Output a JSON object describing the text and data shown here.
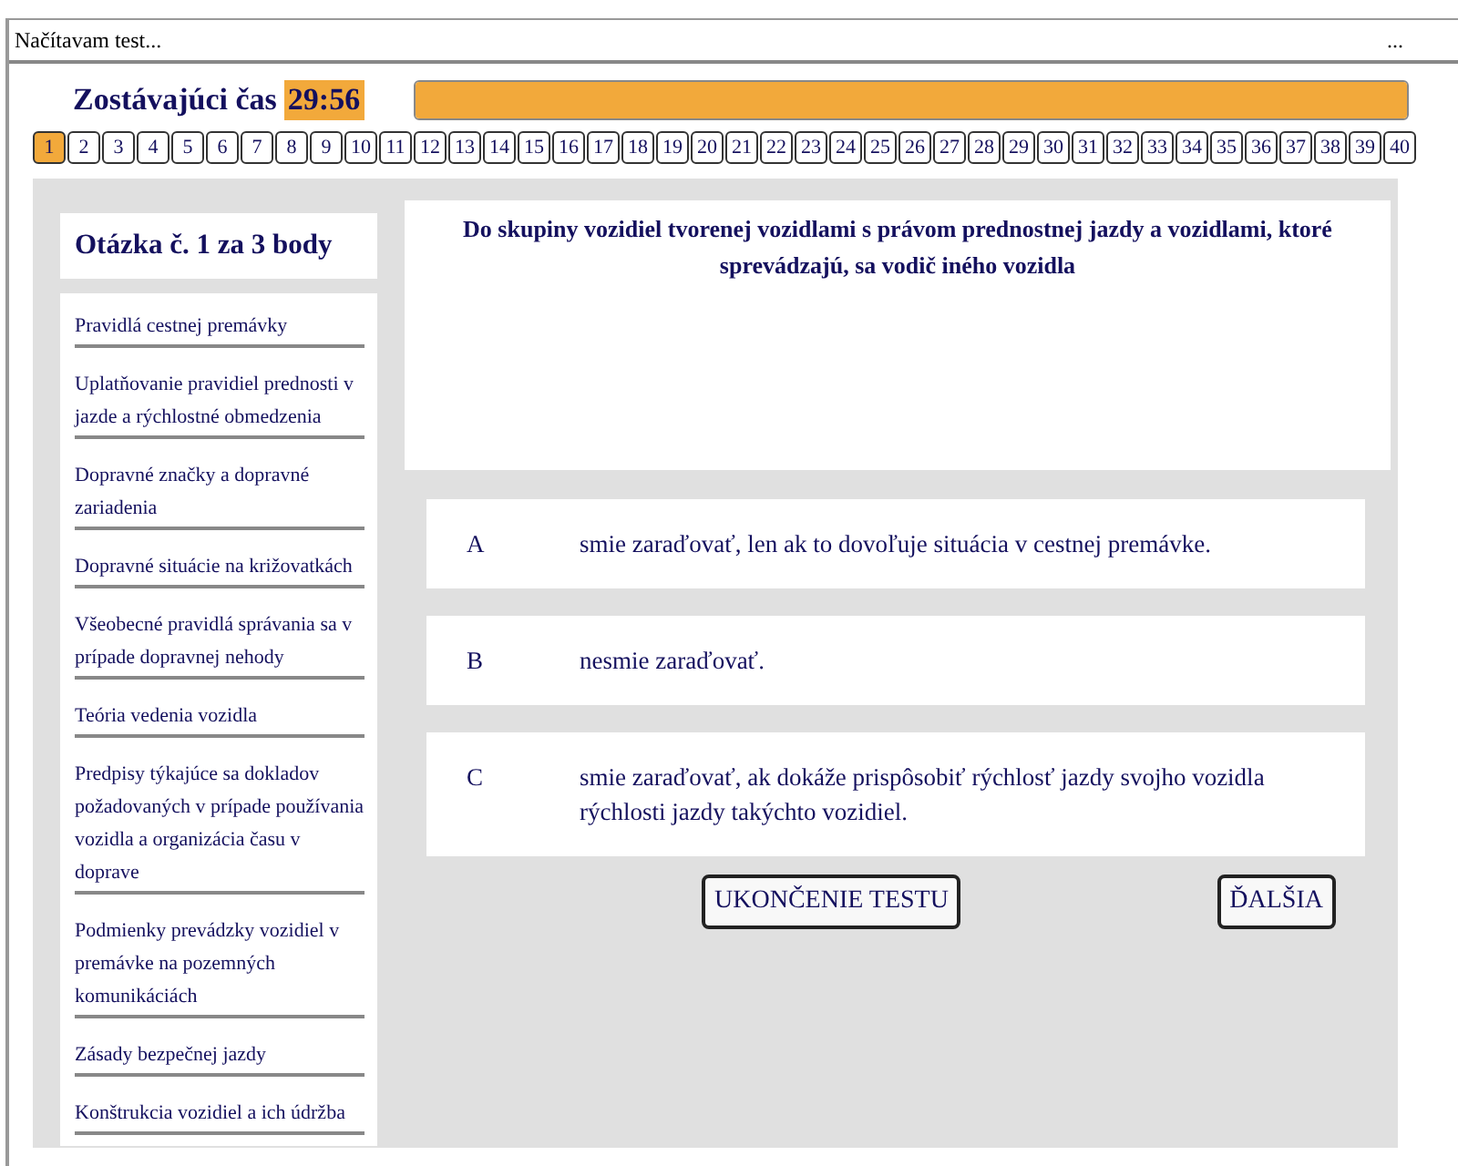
{
  "status_bar": {
    "text": "Načítavam test...",
    "menu": "..."
  },
  "timer": {
    "label": "Zostávajúci čas",
    "time": "29:56",
    "level": 1
  },
  "question_numbers": [
    {
      "label": "1",
      "selected": true
    },
    {
      "label": "2",
      "selected": false
    },
    {
      "label": "3",
      "selected": false
    },
    {
      "label": "4",
      "selected": false
    },
    {
      "label": "5",
      "selected": false
    },
    {
      "label": "6",
      "selected": false
    },
    {
      "label": "7",
      "selected": false
    },
    {
      "label": "8",
      "selected": false
    },
    {
      "label": "9",
      "selected": false
    },
    {
      "label": "10",
      "selected": false
    },
    {
      "label": "11",
      "selected": false
    },
    {
      "label": "12",
      "selected": false
    },
    {
      "label": "13",
      "selected": false
    },
    {
      "label": "14",
      "selected": false
    },
    {
      "label": "15",
      "selected": false
    },
    {
      "label": "16",
      "selected": false
    },
    {
      "label": "17",
      "selected": false
    },
    {
      "label": "18",
      "selected": false
    },
    {
      "label": "19",
      "selected": false
    },
    {
      "label": "20",
      "selected": false
    },
    {
      "label": "21",
      "selected": false
    },
    {
      "label": "22",
      "selected": false
    },
    {
      "label": "23",
      "selected": false
    },
    {
      "label": "24",
      "selected": false
    },
    {
      "label": "25",
      "selected": false
    },
    {
      "label": "26",
      "selected": false
    },
    {
      "label": "27",
      "selected": false
    },
    {
      "label": "28",
      "selected": false
    },
    {
      "label": "29",
      "selected": false
    },
    {
      "label": "30",
      "selected": false
    },
    {
      "label": "31",
      "selected": false
    },
    {
      "label": "32",
      "selected": false
    },
    {
      "label": "33",
      "selected": false
    },
    {
      "label": "34",
      "selected": false
    },
    {
      "label": "35",
      "selected": false
    },
    {
      "label": "36",
      "selected": false
    },
    {
      "label": "37",
      "selected": false
    },
    {
      "label": "38",
      "selected": false
    },
    {
      "label": "39",
      "selected": false
    },
    {
      "label": "40",
      "selected": false
    }
  ],
  "question_title": "Otázka č. 1 za 3 body",
  "categories": [
    "Pravidlá cestnej premávky",
    "Uplatňovanie pravidiel prednosti v jazde a rýchlostné obmedzenia",
    "Dopravné značky a dopravné zariadenia",
    "Dopravné situácie na križovatkách",
    "Všeobecné pravidlá správania sa v prípade dopravnej nehody",
    "Teória vedenia vozidla",
    "Predpisy týkajúce sa dokladov požadovaných v prípade používania vozidla a organizácia času v doprave",
    "Podmienky prevádzky vozidiel v premávke na pozemných komunikáciách",
    "Zásady bezpečnej jazdy",
    "Konštrukcia vozidiel a ich údržba"
  ],
  "question": "Do skupiny vozidiel tvorenej vozidlami s právom prednostnej jazdy a vozidlami, ktoré sprevádzajú, sa vodič iného vozidla",
  "answers": [
    {
      "letter": "A",
      "text": "smie zaraďovať, len ak to dovoľuje situácia v cestnej premávke."
    },
    {
      "letter": "B",
      "text": "nesmie zaraďovať."
    },
    {
      "letter": "C",
      "text": "smie zaraďovať, ak dokáže prispôsobiť rýchlosť jazdy svojho vozidla rýchlosti jazdy takýchto vozidiel."
    }
  ],
  "buttons": [
    "UKONČENIE TESTU",
    "ĎALŠIA"
  ]
}
